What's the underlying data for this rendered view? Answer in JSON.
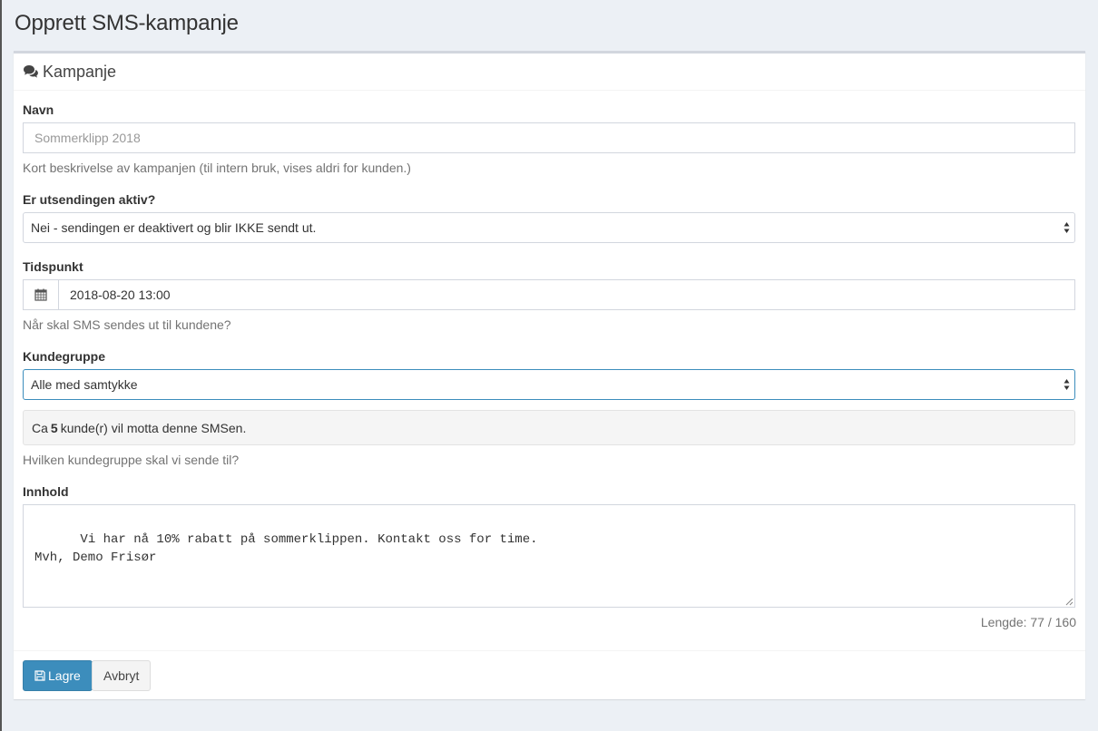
{
  "page": {
    "title": "Opprett SMS-kampanje"
  },
  "box": {
    "title": "Kampanje",
    "icon": "comments-icon"
  },
  "form": {
    "name": {
      "label": "Navn",
      "placeholder": "Sommerklipp 2018",
      "help": "Kort beskrivelse av kampanjen (til intern bruk, vises aldri for kunden.)"
    },
    "active": {
      "label": "Er utsendingen aktiv?",
      "selected": "Nei - sendingen er deaktivert og blir IKKE sendt ut."
    },
    "time": {
      "label": "Tidspunkt",
      "icon": "calendar-icon",
      "value": "2018-08-20 13:00",
      "help": "Når skal SMS sendes ut til kundene?"
    },
    "group": {
      "label": "Kundegruppe",
      "selected": "Alle med samtykke",
      "info_prefix": "Ca",
      "info_count": "5",
      "info_suffix": "kunde(r) vil motta denne SMSen.",
      "help": "Hvilken kundegruppe skal vi sende til?"
    },
    "content": {
      "label": "Innhold",
      "value": "Vi har nå 10% rabatt på sommerklippen. Kontakt oss for time.\nMvh, Demo Frisør",
      "length": "Lengde: 77 / 160"
    }
  },
  "footer": {
    "save_label": "Lagre",
    "save_icon": "floppy-disk-icon",
    "cancel_label": "Avbryt"
  },
  "colors": {
    "primary": "#3c8dbc",
    "background": "#ecf0f5",
    "focus_border": "#3c8dbc"
  }
}
